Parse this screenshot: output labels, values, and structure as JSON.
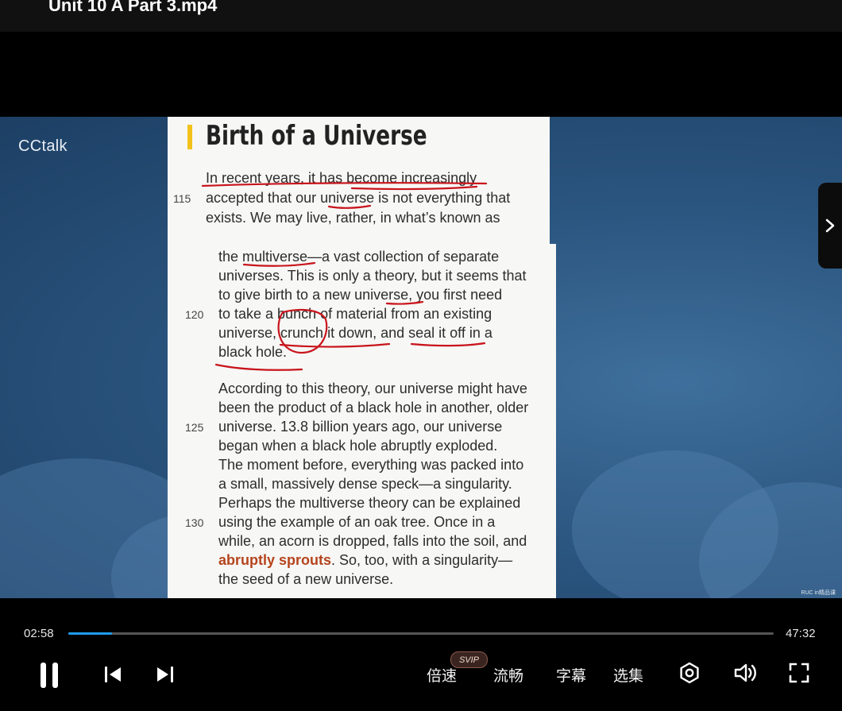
{
  "window": {
    "title": "Unit 10 A Part 3.mp4"
  },
  "video": {
    "brand": "CCtalk",
    "watermark": "RUC in精品课",
    "heading": "Birth of a Universe",
    "lines_top": [
      {
        "num": "",
        "text": "In recent years, it has become increasingly"
      },
      {
        "num": "115",
        "text": "accepted that our universe is not everything that"
      },
      {
        "num": "",
        "text": "exists. We may live, rather, in what’s known as"
      }
    ],
    "lines_bottom": [
      {
        "num": "",
        "text": "the multiverse—a vast collection of separate"
      },
      {
        "num": "",
        "text": "universes. This is only a theory, but it seems that"
      },
      {
        "num": "",
        "text": "to give birth to a new universe, you first need"
      },
      {
        "num": "120",
        "text": "to take a bunch of material from an existing"
      },
      {
        "num": "",
        "text": "universe, crunch it down, and seal it off in a"
      },
      {
        "num": "",
        "text": "black hole."
      },
      {
        "num": "",
        "text": "According to this theory, our universe might have"
      },
      {
        "num": "",
        "text": "been the product of a black hole in another, older"
      },
      {
        "num": "125",
        "text": "universe. 13.8 billion years ago, our universe"
      },
      {
        "num": "",
        "text": "began when a black hole abruptly exploded."
      },
      {
        "num": "",
        "text": "The moment before, everything was packed into"
      },
      {
        "num": "",
        "text": "a small, massively dense speck—a singularity."
      },
      {
        "num": "",
        "text": "Perhaps the multiverse theory can be explained"
      },
      {
        "num": "130",
        "text": "using the example of an oak tree. Once in a"
      },
      {
        "num": "",
        "text": "while, an acorn is dropped, falls into the soil, and"
      },
      {
        "num": "",
        "highlight": "abruptly sprouts",
        "text": ". So, too, with a singularity—"
      },
      {
        "num": "",
        "text": "the seed of a new universe."
      }
    ],
    "next_icon": "chevron-right-icon"
  },
  "player": {
    "current_time": "02:58",
    "total_time": "47:32",
    "progress_fraction": 0.062,
    "speed_label": "倍速",
    "svip_badge": "SVIP",
    "quality_label": "流畅",
    "subtitle_label": "字幕",
    "episodes_label": "选集",
    "accent_color": "#1e9bf0",
    "icons": [
      "pause-icon",
      "previous-icon",
      "next-icon",
      "settings-icon",
      "volume-icon",
      "fullscreen-icon"
    ]
  }
}
